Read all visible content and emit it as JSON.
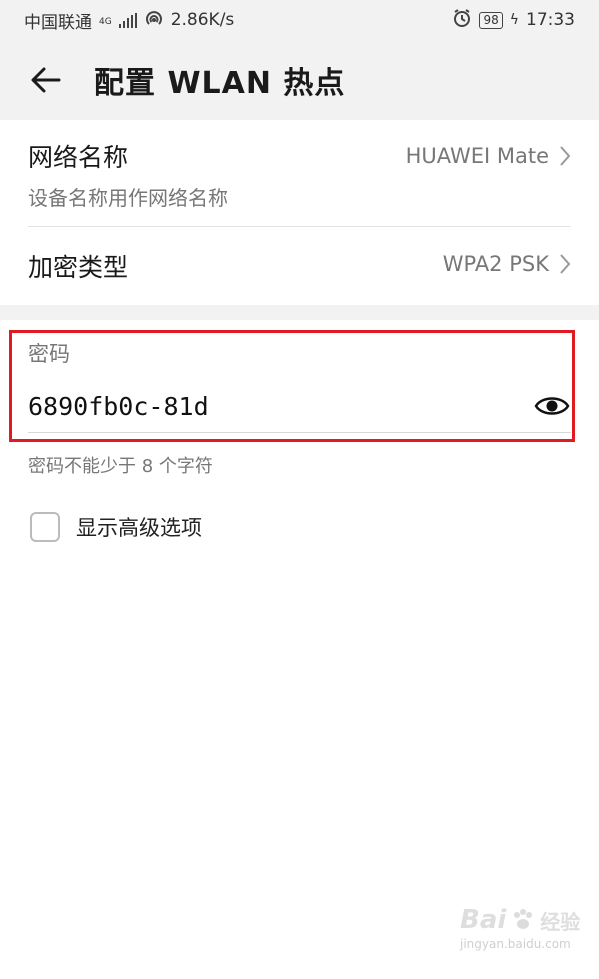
{
  "status_bar": {
    "carrier": "中国联通",
    "network_badge": "4G",
    "speed": "2.86K/s",
    "battery": "98",
    "time": "17:33",
    "icons": [
      "signal-icon",
      "hotspot-icon",
      "alarm-icon",
      "battery-icon",
      "charging-icon"
    ]
  },
  "header": {
    "title": "配置 WLAN 热点",
    "back_icon": "arrow-left-icon"
  },
  "settings": {
    "network_name": {
      "label": "网络名称",
      "sublabel": "设备名称用作网络名称",
      "value": "HUAWEI Mate"
    },
    "encryption": {
      "label": "加密类型",
      "value": "WPA2 PSK"
    }
  },
  "password": {
    "label": "密码",
    "value": "6890fb0c-81d",
    "hint": "密码不能少于 8 个字符",
    "toggle_icon": "eye-icon"
  },
  "advanced": {
    "label": "显示高级选项",
    "checked": false
  },
  "watermark": {
    "text": "Bai",
    "suffix": "经验",
    "url": "jingyan.baidu.com"
  },
  "colors": {
    "highlight": "#e11b22",
    "background_gray": "#f2f2f2",
    "secondary_text": "#777777"
  }
}
